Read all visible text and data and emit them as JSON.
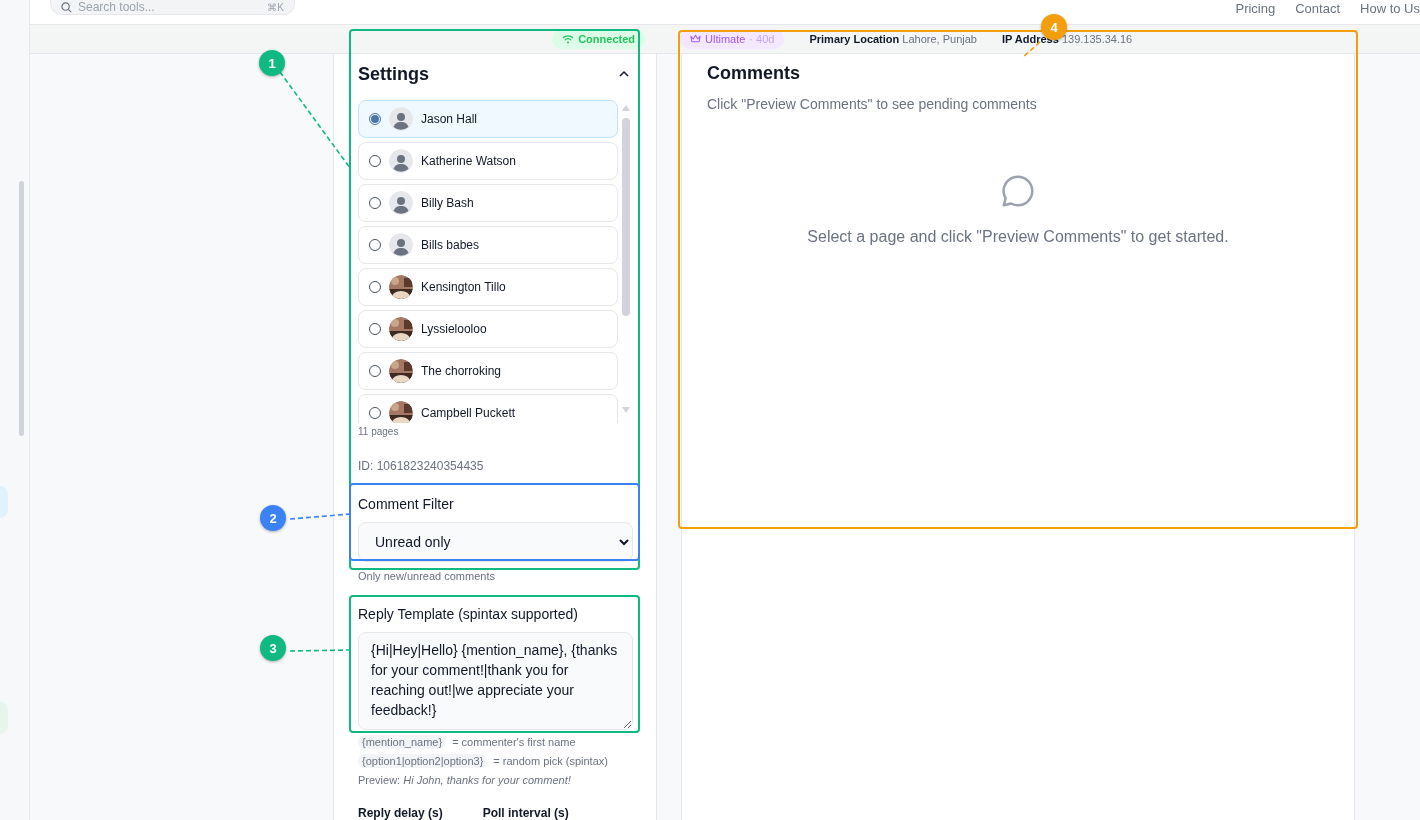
{
  "header": {
    "search": {
      "placeholder": "Search tools...",
      "shortcut": "⌘K"
    },
    "nav": [
      "Pricing",
      "Contact",
      "How to Us"
    ]
  },
  "status_bar": {
    "connection": "Connected",
    "plan": "Ultimate",
    "plan_days": "· 40d",
    "location_label": "Primary Location",
    "location": "Lahore, Punjab",
    "ip_label": "IP Address",
    "ip": "139.135.34.16"
  },
  "settings": {
    "title": "Settings",
    "expanded": true,
    "pages": [
      {
        "name": "Jason Hall",
        "selected": true,
        "kind": "default"
      },
      {
        "name": "Katherine Watson",
        "selected": false,
        "kind": "default"
      },
      {
        "name": "Billy Bash",
        "selected": false,
        "kind": "default"
      },
      {
        "name": "Bills babes",
        "selected": false,
        "kind": "default"
      },
      {
        "name": "Kensington Tillo",
        "selected": false
      },
      {
        "name": "Lyssielooloo",
        "selected": false
      },
      {
        "name": "The chorroking",
        "selected": false
      },
      {
        "name": "Campbell Puckett",
        "selected": false
      }
    ],
    "page_count": "11 pages",
    "page_id": "ID: 1061823240354435",
    "filter": {
      "label": "Comment Filter",
      "value": "Unread only",
      "hint": "Only new/unread comments"
    },
    "template": {
      "label": "Reply Template (spintax supported)",
      "value": "{Hi|Hey|Hello} {mention_name}, {thanks for your comment!|thank you for reaching out!|we appreciate your feedback!}",
      "hints": [
        {
          "code": "{mention_name}",
          "text": "= commenter's first name"
        },
        {
          "code": "{option1|option2|option3}",
          "text": "= random pick (spintax)"
        }
      ],
      "preview": "Preview: *Hi John, thanks for your comment!*"
    },
    "fields": [
      "Reply delay (s)",
      "Poll interval (s)"
    ]
  },
  "comments": {
    "title": "Comments",
    "subtitle": "Click \"Preview Comments\" to see pending comments",
    "empty": "Select a page and click \"Preview Comments\" to get started."
  },
  "annotations": [
    {
      "number": "1",
      "color": "#10b981"
    },
    {
      "number": "2",
      "color": "#3b82f6"
    },
    {
      "number": "3",
      "color": "#10b981"
    },
    {
      "number": "4",
      "color": "#f59e0b"
    }
  ]
}
